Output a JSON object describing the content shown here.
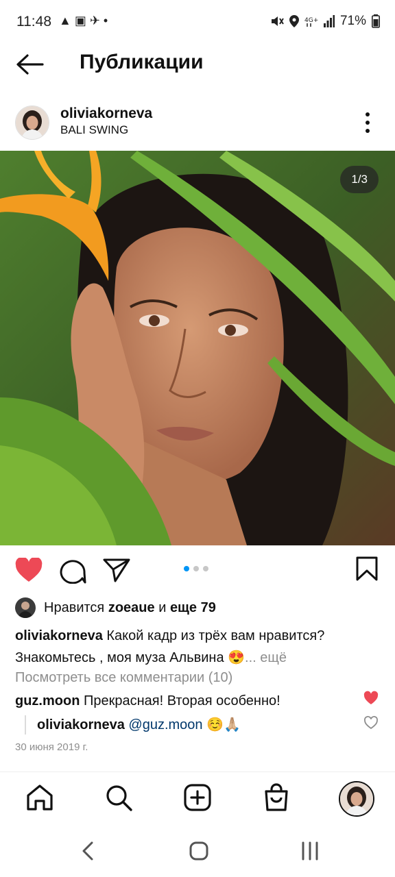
{
  "status_bar": {
    "time": "11:48",
    "left_icons": "▲ ▣ ✈ •",
    "battery": "71%"
  },
  "header": {
    "title": "Публикации"
  },
  "post": {
    "username": "oliviakorneva",
    "location": "BALI SWING",
    "counter": "1/3",
    "likes": {
      "prefix": "Нравится",
      "user": "zoeaue",
      "connector": "и",
      "others": "еще 79"
    },
    "caption": {
      "username": "oliviakorneva",
      "text": "Какой кадр из трёх вам нравится? Знакомьтесь , моя муза Альвина 😍",
      "more": "... ещё"
    },
    "view_comments": "Посмотреть все комментарии (10)",
    "comments": [
      {
        "username": "guz.moon",
        "text": "Прекрасная! Вторая особенно!"
      },
      {
        "username": "oliviakorneva",
        "mention": "@guz.moon",
        "text": "☺️🙏🏼"
      }
    ],
    "date": "30 июня 2019 г.",
    "carousel": {
      "current": 1,
      "total": 3
    }
  },
  "colors": {
    "like_red": "#ed4956",
    "accent_blue": "#0095f6",
    "mention_blue": "#00376b"
  },
  "icons": {
    "header": [
      "back-arrow-icon"
    ],
    "actions": [
      "heart-icon",
      "comment-icon",
      "share-icon",
      "bookmark-icon"
    ],
    "nav": [
      "home-icon",
      "search-icon",
      "create-icon",
      "shop-icon",
      "profile-avatar"
    ],
    "system": [
      "system-back-icon",
      "system-home-icon",
      "system-recents-icon"
    ]
  }
}
